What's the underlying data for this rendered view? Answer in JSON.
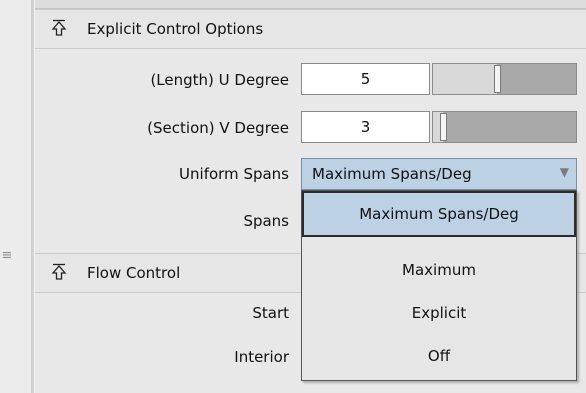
{
  "panel": {
    "side_grip": "≡"
  },
  "sections": {
    "explicit_control": {
      "title": "Explicit Control Options",
      "collapse_icon": "collapse-up-arrow-icon",
      "length_u_degree": {
        "label": "(Length) U Degree",
        "value": "5",
        "slider_level": 0.45
      },
      "section_v_degree": {
        "label": "(Section) V Degree",
        "value": "3",
        "slider_level": 0.05
      },
      "uniform_spans": {
        "label": "Uniform Spans",
        "selected": "Maximum Spans/Deg",
        "arrow_icon": "dropdown-triangle-icon"
      },
      "spans": {
        "label": "Spans"
      }
    },
    "flow_control": {
      "title": "Flow Control",
      "collapse_icon": "collapse-up-arrow-icon",
      "start_label": "Start",
      "interior_label": "Interior"
    }
  },
  "dropdown_menu": {
    "options": [
      "Maximum Spans/Deg",
      "Maximum",
      "Explicit",
      "Off"
    ],
    "selected_index": 0
  },
  "colors": {
    "selection": "#bcd1e4",
    "panel_bg": "#e8e8e8",
    "header_bg": "#e6e6e6"
  }
}
